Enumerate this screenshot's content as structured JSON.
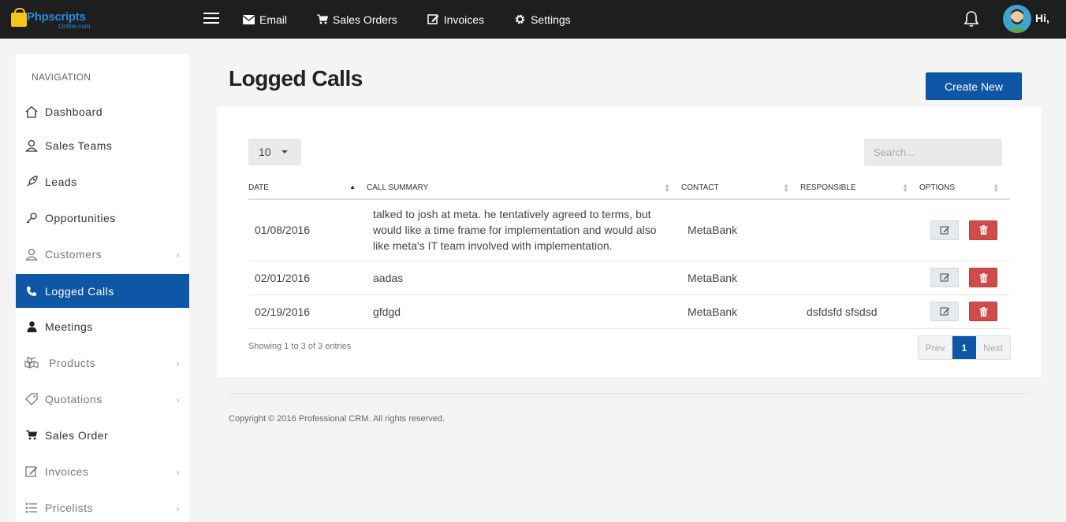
{
  "header": {
    "logo_main": "Phpscripts",
    "logo_sub": "Online.com",
    "nav": [
      {
        "label": "Email",
        "icon": "envelope-icon"
      },
      {
        "label": "Sales Orders",
        "icon": "cart-icon"
      },
      {
        "label": "Invoices",
        "icon": "edit-icon"
      },
      {
        "label": "Settings",
        "icon": "gear-icon"
      }
    ],
    "greeting": "Hi,"
  },
  "sidebar": {
    "heading": "NAVIGATION",
    "items": [
      {
        "label": "Dashboard",
        "icon": "home-icon"
      },
      {
        "label": "Sales Teams",
        "icon": "user-outline-icon"
      },
      {
        "label": "Leads",
        "icon": "rocket-icon"
      },
      {
        "label": "Opportunities",
        "icon": "key-icon"
      },
      {
        "label": "Customers",
        "icon": "user-icon"
      },
      {
        "label": "Logged Calls",
        "icon": "phone-icon"
      },
      {
        "label": "Meetings",
        "icon": "person-icon"
      },
      {
        "label": "Products",
        "icon": "cubes-icon"
      },
      {
        "label": "Quotations",
        "icon": "tag-icon"
      },
      {
        "label": "Sales Order",
        "icon": "cart-icon"
      },
      {
        "label": "Invoices",
        "icon": "edit-icon"
      },
      {
        "label": "Pricelists",
        "icon": "list-icon"
      }
    ]
  },
  "main": {
    "title": "Logged Calls",
    "create_label": "Create New",
    "page_length": "10",
    "search_placeholder": "Search...",
    "columns": [
      "DATE",
      "CALL SUMMARY",
      "CONTACT",
      "RESPONSIBLE",
      "OPTIONS"
    ],
    "rows": [
      {
        "date": "01/08/2016",
        "summary": "talked to josh at meta. he tentatively agreed to terms, but would like a time frame for implementation and would also like meta's IT team involved with implementation.",
        "contact": "MetaBank",
        "responsible": ""
      },
      {
        "date": "02/01/2016",
        "summary": "aadas",
        "contact": "MetaBank",
        "responsible": ""
      },
      {
        "date": "02/19/2016",
        "summary": "gfdgd",
        "contact": "MetaBank",
        "responsible": "dsfdsfd sfsdsd"
      }
    ],
    "info": "Showing 1 to 3 of 3 entries",
    "pager": {
      "prev": "Prev",
      "current": "1",
      "next": "Next"
    }
  },
  "footer": {
    "copyright": "Copyright © 2016 Professional CRM. All rights reserved."
  },
  "colors": {
    "topbar": "#1e1e1e",
    "accent": "#0e56a6",
    "delete": "#cf4c4c"
  }
}
